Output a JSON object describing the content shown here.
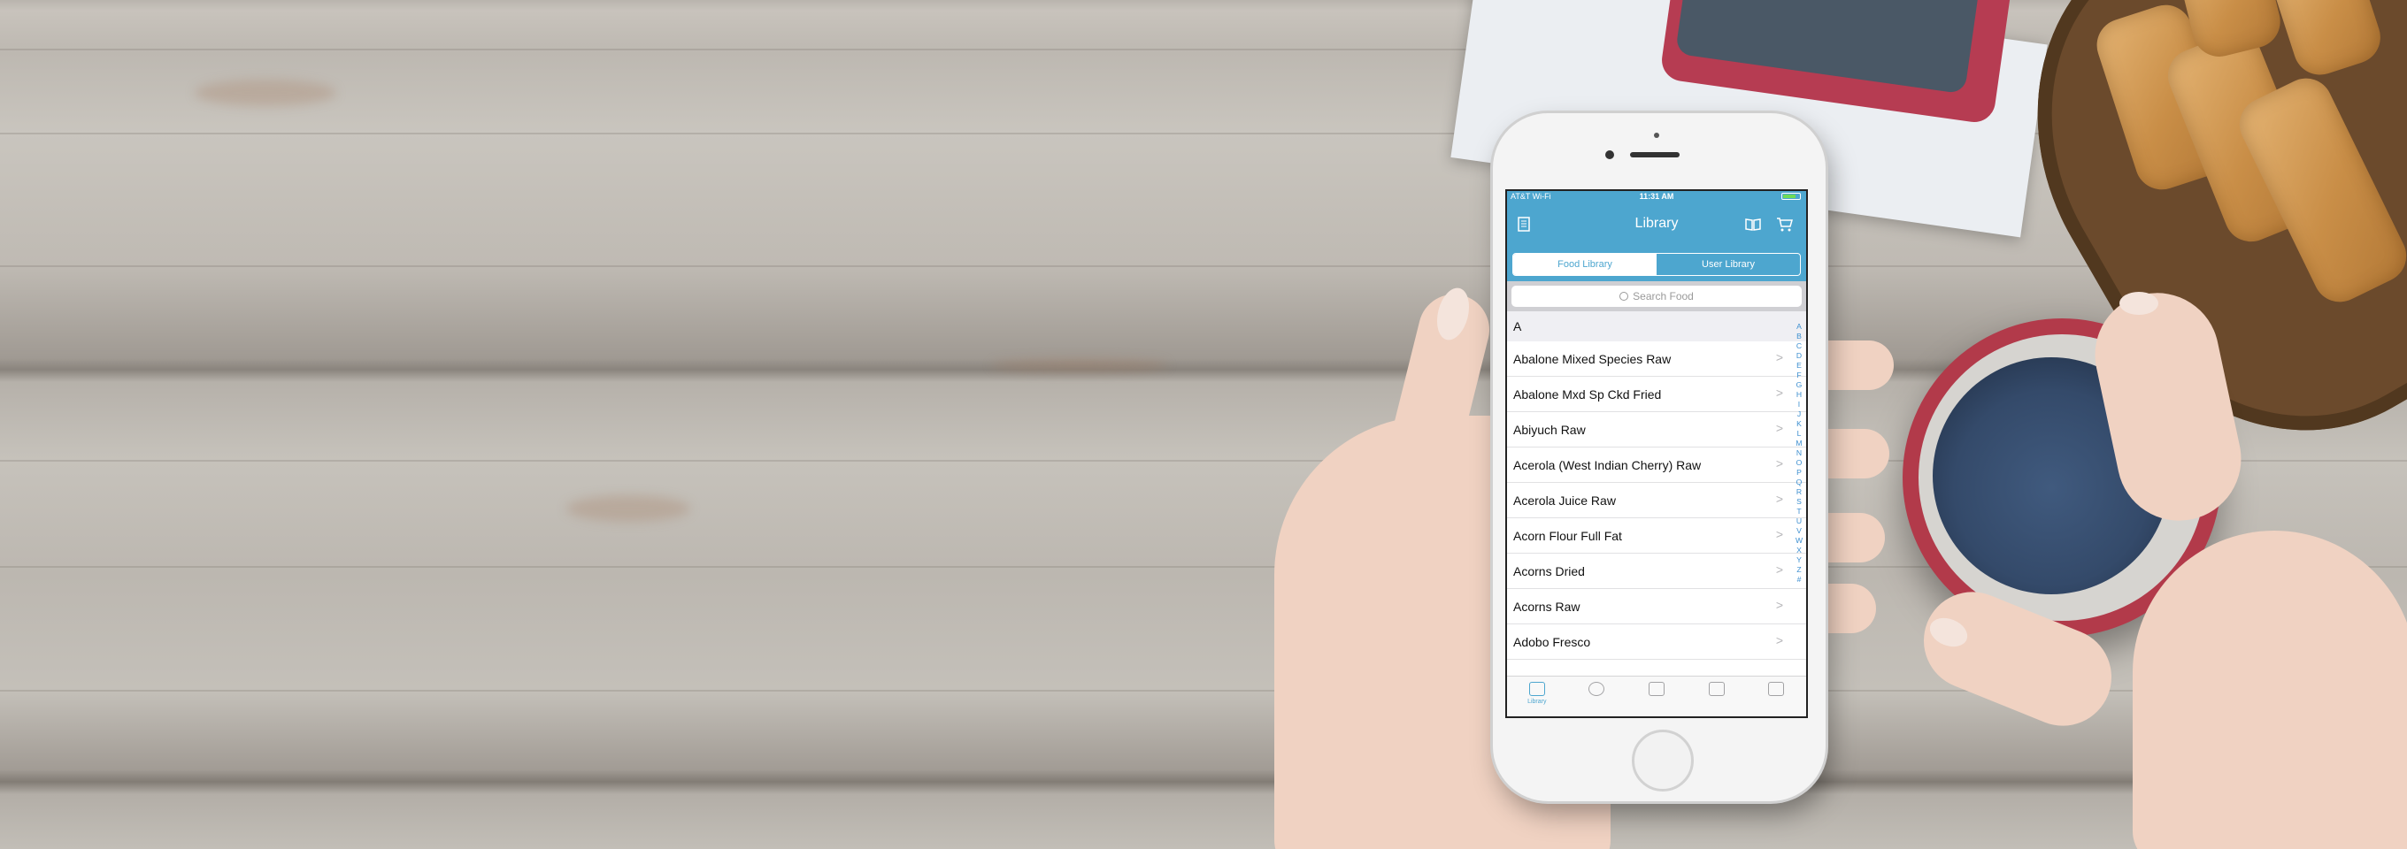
{
  "status_bar": {
    "carrier": "AT&T Wi-Fi",
    "time": "11:31 AM"
  },
  "nav": {
    "title": "Library",
    "left_icon": "document-list-icon",
    "right_icons": [
      "book-icon",
      "cart-icon"
    ]
  },
  "segments": {
    "food_library": "Food Library",
    "user_library": "User Library",
    "selected": "Food Library"
  },
  "search": {
    "placeholder": "Search Food"
  },
  "section": {
    "header": "A"
  },
  "items": [
    {
      "label": "Abalone Mixed Species Raw"
    },
    {
      "label": "Abalone Mxd Sp Ckd Fried"
    },
    {
      "label": "Abiyuch Raw"
    },
    {
      "label": "Acerola (West Indian Cherry) Raw"
    },
    {
      "label": "Acerola Juice Raw"
    },
    {
      "label": "Acorn Flour Full Fat"
    },
    {
      "label": "Acorns Dried"
    },
    {
      "label": "Acorns Raw"
    },
    {
      "label": "Adobo Fresco"
    }
  ],
  "index_letters": [
    "A",
    "B",
    "C",
    "D",
    "E",
    "F",
    "G",
    "H",
    "I",
    "J",
    "K",
    "L",
    "M",
    "N",
    "O",
    "P",
    "Q",
    "R",
    "S",
    "T",
    "U",
    "V",
    "W",
    "X",
    "Y",
    "Z",
    "#"
  ],
  "tabs": [
    {
      "label": "Library",
      "icon": "library-icon",
      "active": true
    },
    {
      "label": "",
      "icon": "goal-icon",
      "active": false
    },
    {
      "label": "",
      "icon": "chart-icon",
      "active": false
    },
    {
      "label": "",
      "icon": "diary-icon",
      "active": false
    },
    {
      "label": "",
      "icon": "more-icon",
      "active": false
    }
  ],
  "colors": {
    "accent": "#4da6cf",
    "index": "#3d8fd0"
  }
}
